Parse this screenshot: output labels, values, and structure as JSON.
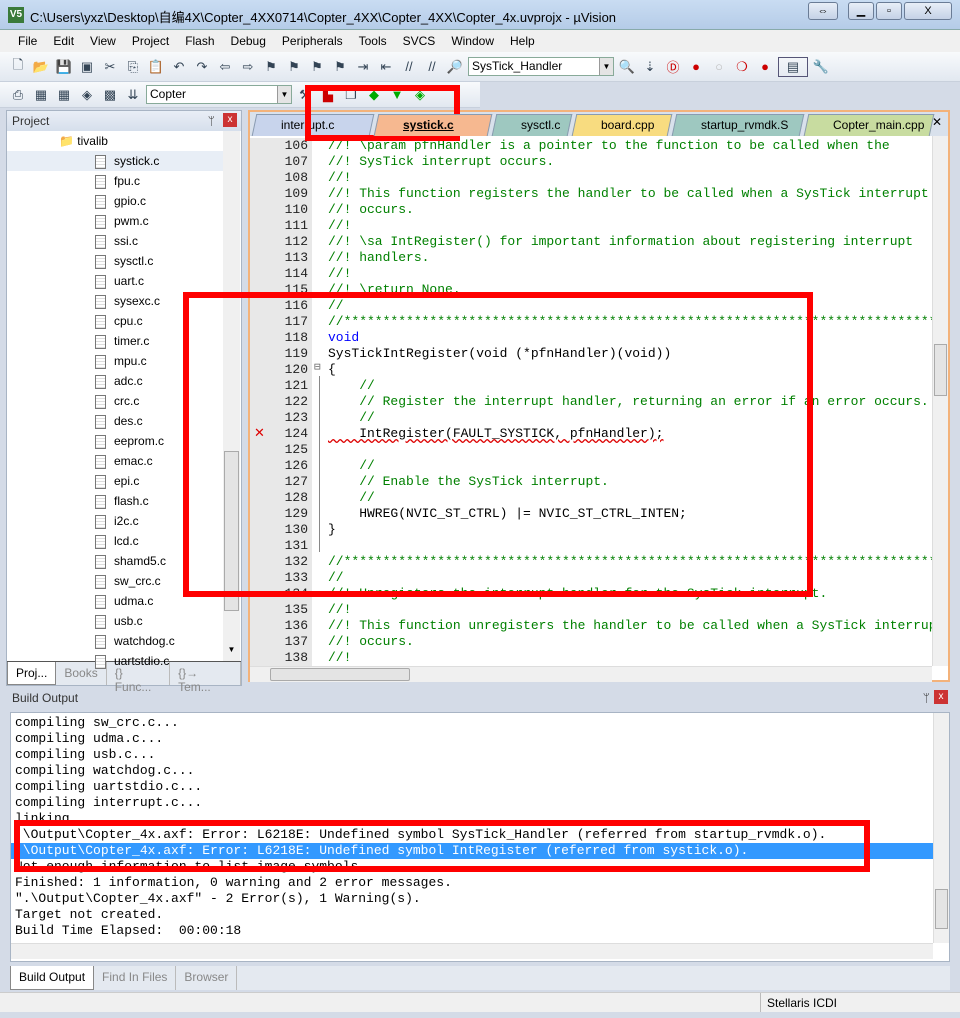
{
  "window": {
    "title": "C:\\Users\\yxz\\Desktop\\自编4X\\Copter_4XX0714\\Copter_4XX\\Copter_4XX\\Copter_4x.uvprojx - µVision",
    "app_icon": "V5"
  },
  "menu": [
    "File",
    "Edit",
    "View",
    "Project",
    "Flash",
    "Debug",
    "Peripherals",
    "Tools",
    "SVCS",
    "Window",
    "Help"
  ],
  "toolbar": {
    "find_combo": "SysTick_Handler",
    "target_combo": "Copter"
  },
  "project": {
    "title": "Project",
    "folder": "tivalib",
    "selected": "systick.c",
    "files": [
      "systick.c",
      "fpu.c",
      "gpio.c",
      "pwm.c",
      "ssi.c",
      "sysctl.c",
      "uart.c",
      "sysexc.c",
      "cpu.c",
      "timer.c",
      "mpu.c",
      "adc.c",
      "crc.c",
      "des.c",
      "eeprom.c",
      "emac.c",
      "epi.c",
      "flash.c",
      "i2c.c",
      "lcd.c",
      "shamd5.c",
      "sw_crc.c",
      "udma.c",
      "usb.c",
      "watchdog.c",
      "uartstdio.c"
    ],
    "tabs": [
      "Proj...",
      "Books",
      "{} Func...",
      "{}→ Tem..."
    ]
  },
  "editor": {
    "tabs": [
      {
        "label": "interrupt.c",
        "color": "#c8d4ec"
      },
      {
        "label": "systick.c",
        "color": "#f6b890",
        "active": true
      },
      {
        "label": "sysctl.c",
        "color": "#9ec8c0"
      },
      {
        "label": "board.cpp",
        "color": "#f8dc80"
      },
      {
        "label": "startup_rvmdk.S",
        "color": "#9ec8c0"
      },
      {
        "label": "Copter_main.cpp",
        "color": "#c8dca0"
      }
    ],
    "error_line": 124,
    "lines": [
      {
        "n": "106",
        "t": "//! \\param pfnHandler is a pointer to the function to be called when the"
      },
      {
        "n": "107",
        "t": "//! SysTick interrupt occurs."
      },
      {
        "n": "108",
        "t": "//!"
      },
      {
        "n": "109",
        "t": "//! This function registers the handler to be called when a SysTick interrupt"
      },
      {
        "n": "110",
        "t": "//! occurs."
      },
      {
        "n": "111",
        "t": "//!"
      },
      {
        "n": "112",
        "t": "//! \\sa IntRegister() for important information about registering interrupt"
      },
      {
        "n": "113",
        "t": "//! handlers."
      },
      {
        "n": "114",
        "t": "//!"
      },
      {
        "n": "115",
        "t": "//! \\return None."
      },
      {
        "n": "116",
        "t": "//"
      },
      {
        "n": "117",
        "t": "//*****************************************************************************"
      },
      {
        "n": "118",
        "t": "void",
        "k": "kw"
      },
      {
        "n": "119",
        "t": "SysTickIntRegister(void (*pfnHandler)(void))",
        "k": "black"
      },
      {
        "n": "120",
        "t": "{",
        "k": "black"
      },
      {
        "n": "121",
        "t": "    //"
      },
      {
        "n": "122",
        "t": "    // Register the interrupt handler, returning an error if an error occurs."
      },
      {
        "n": "123",
        "t": "    //"
      },
      {
        "n": "124",
        "t": "    IntRegister(FAULT_SYSTICK, pfnHandler);",
        "k": "black"
      },
      {
        "n": "125",
        "t": ""
      },
      {
        "n": "126",
        "t": "    //"
      },
      {
        "n": "127",
        "t": "    // Enable the SysTick interrupt."
      },
      {
        "n": "128",
        "t": "    //"
      },
      {
        "n": "129",
        "t": "    HWREG(NVIC_ST_CTRL) |= NVIC_ST_CTRL_INTEN;",
        "k": "black"
      },
      {
        "n": "130",
        "t": "}",
        "k": "black"
      },
      {
        "n": "131",
        "t": ""
      },
      {
        "n": "132",
        "t": "//*****************************************************************************"
      },
      {
        "n": "133",
        "t": "//"
      },
      {
        "n": "134",
        "t": "//! Unregisters the interrupt handler for the SysTick interrupt."
      },
      {
        "n": "135",
        "t": "//!"
      },
      {
        "n": "136",
        "t": "//! This function unregisters the handler to be called when a SysTick interrupt"
      },
      {
        "n": "137",
        "t": "//! occurs."
      },
      {
        "n": "138",
        "t": "//!"
      }
    ]
  },
  "build_output": {
    "title": "Build Output",
    "selected_index": 9,
    "lines": [
      "compiling sw_crc.c...",
      "compiling udma.c...",
      "compiling usb.c...",
      "compiling watchdog.c...",
      "compiling uartstdio.c...",
      "compiling interrupt.c...",
      "linking...",
      ".\\Output\\Copter_4x.axf: Error: L6218E: Undefined symbol SysTick_Handler (referred from startup_rvmdk.o).",
      ".\\Output\\Copter_4x.axf: Error: L6218E: Undefined symbol IntRegister (referred from systick.o).",
      "Not enough information to list image symbols.",
      "Finished: 1 information, 0 warning and 2 error messages.",
      "\".\\Output\\Copter_4x.axf\" - 2 Error(s), 1 Warning(s).",
      "Target not created.",
      "Build Time Elapsed:  00:00:18"
    ],
    "tabs": [
      "Build Output",
      "Find In Files",
      "Browser"
    ]
  },
  "status": {
    "debugger": "Stellaris ICDI"
  },
  "colors": {
    "annotation": "#ff0000",
    "selection": "#3399ff",
    "comment": "#008000",
    "keyword": "#0000ff"
  }
}
